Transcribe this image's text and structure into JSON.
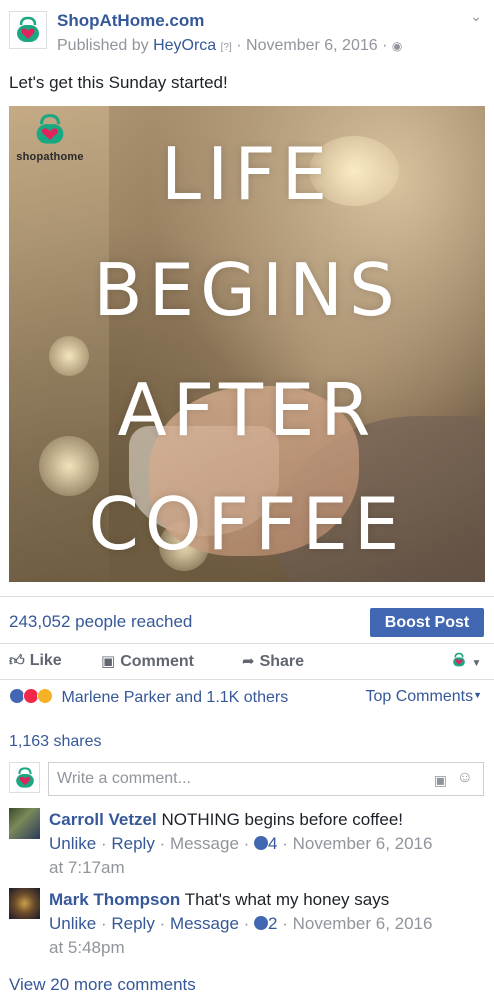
{
  "post": {
    "page_name": "ShopAtHome.com",
    "published_by_prefix": "Published by",
    "publisher": "HeyOrca",
    "publisher_badge": "[?]",
    "date": "November 6, 2016",
    "separator": "·",
    "text": "Let's get this Sunday started!",
    "privacy_icon": "globe-icon",
    "menu_icon": "chevron-down-icon"
  },
  "image": {
    "logo_text": "shopathome",
    "quote_lines": [
      "LIFE",
      "BEGINS",
      "AFTER",
      "COFFEE"
    ]
  },
  "stats": {
    "reach": "243,052 people reached",
    "boost_label": "Boost Post"
  },
  "actions": {
    "like": "Like",
    "comment": "Comment",
    "share": "Share"
  },
  "reactions": {
    "summary": "Marlene Parker and 1.1K others",
    "top_comments": "Top Comments",
    "types": [
      "like",
      "love",
      "haha"
    ]
  },
  "shares": "1,163 shares",
  "comment_input": {
    "placeholder": "Write a comment..."
  },
  "comments": [
    {
      "name": "Carroll Vetzel",
      "text": "NOTHING begins before coffee!",
      "unlike": "Unlike",
      "reply": "Reply",
      "message": "Message",
      "likes": "4",
      "date_line1": "November 6, 2016",
      "date_line2": "at 7:17am"
    },
    {
      "name": "Mark Thompson",
      "text": "That's what my honey says",
      "unlike": "Unlike",
      "reply": "Reply",
      "message": "Message",
      "likes": "2",
      "date_line1": "November 6, 2016",
      "date_line2": "at 5:48pm"
    }
  ],
  "view_more": "View 20 more comments",
  "colors": {
    "link": "#365899",
    "boost": "#4267b2",
    "muted": "#90949c",
    "brand_green": "#1aa782",
    "brand_pink": "#e0245e"
  }
}
